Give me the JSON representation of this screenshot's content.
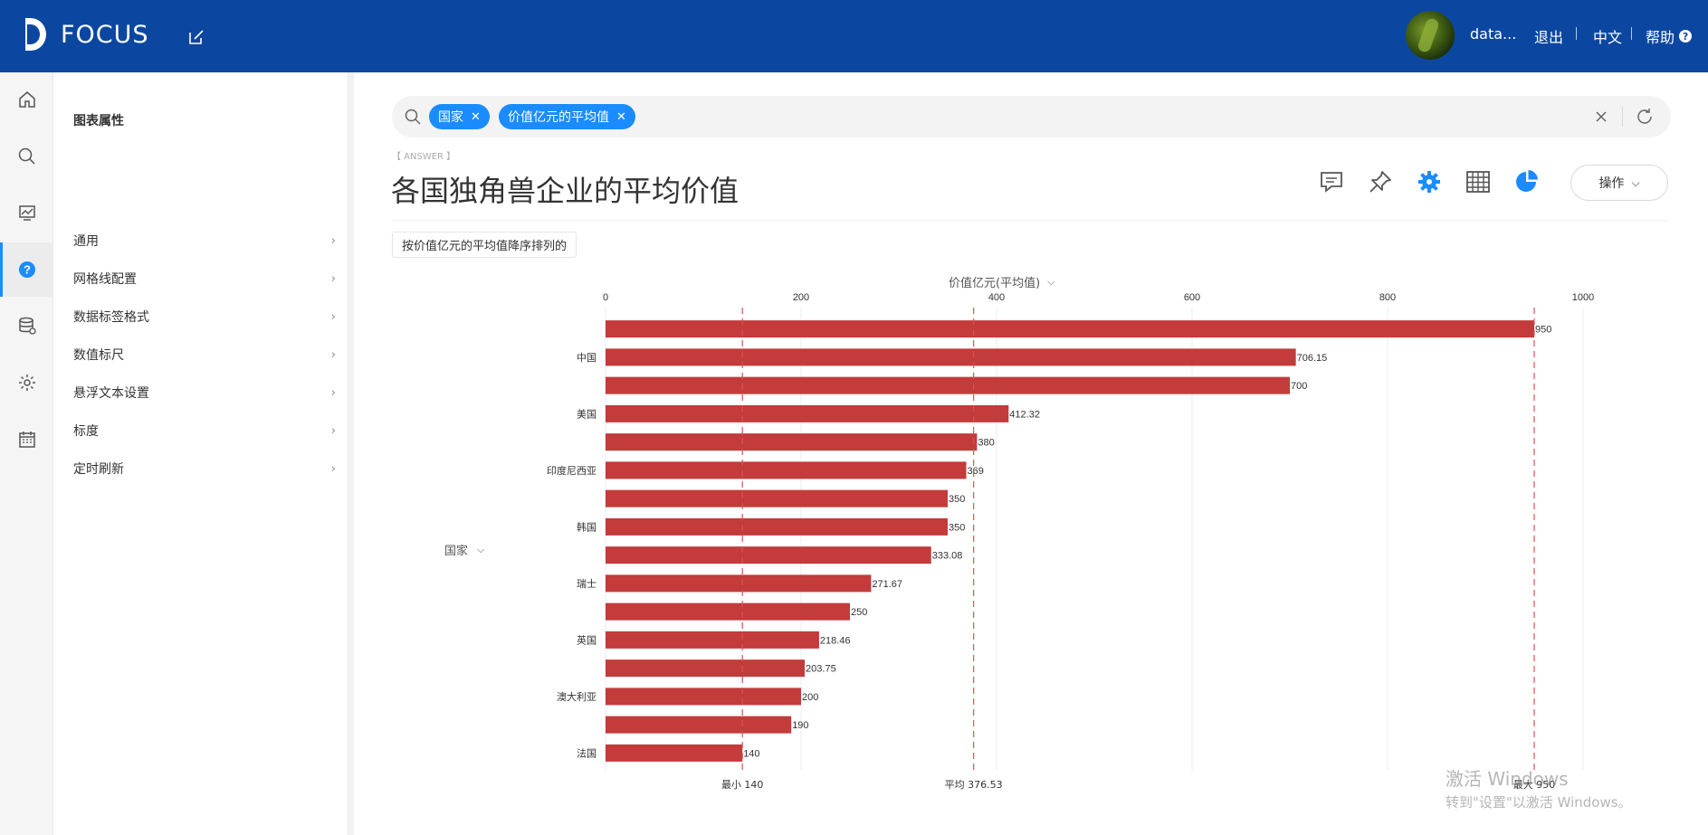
{
  "app": {
    "name": "FOCUS"
  },
  "header": {
    "user_name": "data...",
    "logout": "退出",
    "language": "中文",
    "help": "帮助",
    "help_badge": "?"
  },
  "rail": {
    "items": [
      {
        "icon": "home-icon"
      },
      {
        "icon": "search-icon"
      },
      {
        "icon": "dashboard-icon"
      },
      {
        "icon": "question-icon",
        "active": true
      },
      {
        "icon": "database-icon"
      },
      {
        "icon": "gear-icon"
      },
      {
        "icon": "calendar-icon"
      }
    ]
  },
  "panel": {
    "title": "图表属性",
    "items": [
      "通用",
      "网格线配置",
      "数据标签格式",
      "数值标尺",
      "悬浮文本设置",
      "标度",
      "定时刷新"
    ]
  },
  "search": {
    "chips": [
      "国家",
      "价值亿元的平均值"
    ]
  },
  "answer": {
    "tag": "【 ANSWER 】",
    "title": "各国独角兽企业的平均价值",
    "ops_label": "操作",
    "sort_note": "按价值亿元的平均值降序排列的"
  },
  "colors": {
    "brand": "#0b47a1",
    "accent": "#1a8cff",
    "bar": "#c33b3b",
    "refline": "#d9534f"
  },
  "chart_data": {
    "type": "bar",
    "orientation": "horizontal",
    "xlabel": "价值亿元(平均值)",
    "ylabel": "国家",
    "xlim": [
      0,
      1000
    ],
    "xticks": [
      0,
      200,
      400,
      600,
      800,
      1000
    ],
    "categories": [
      "",
      "中国",
      "",
      "美国",
      "",
      "印度尼西亚",
      "",
      "韩国",
      "",
      "瑞士",
      "",
      "英国",
      "",
      "澳大利亚",
      "",
      "法国"
    ],
    "values": [
      950,
      706.15,
      700,
      412.32,
      380,
      369,
      350,
      350,
      333.08,
      271.67,
      250,
      218.46,
      203.75,
      200,
      190,
      140
    ],
    "value_labels": [
      "950",
      "706.15",
      "700",
      "412.32",
      "380",
      "369",
      "350",
      "350",
      "333.08",
      "271.67",
      "250",
      "218.46",
      "203.75",
      "200",
      "190",
      "140"
    ],
    "reference_lines": [
      {
        "label": "最小 140",
        "value": 140
      },
      {
        "label": "平均 376.53",
        "value": 376.53
      },
      {
        "label": "最大 950",
        "value": 950
      }
    ],
    "grid": true
  },
  "watermark": {
    "line1": "激活 Windows",
    "line2": "转到\"设置\"以激活 Windows。"
  }
}
